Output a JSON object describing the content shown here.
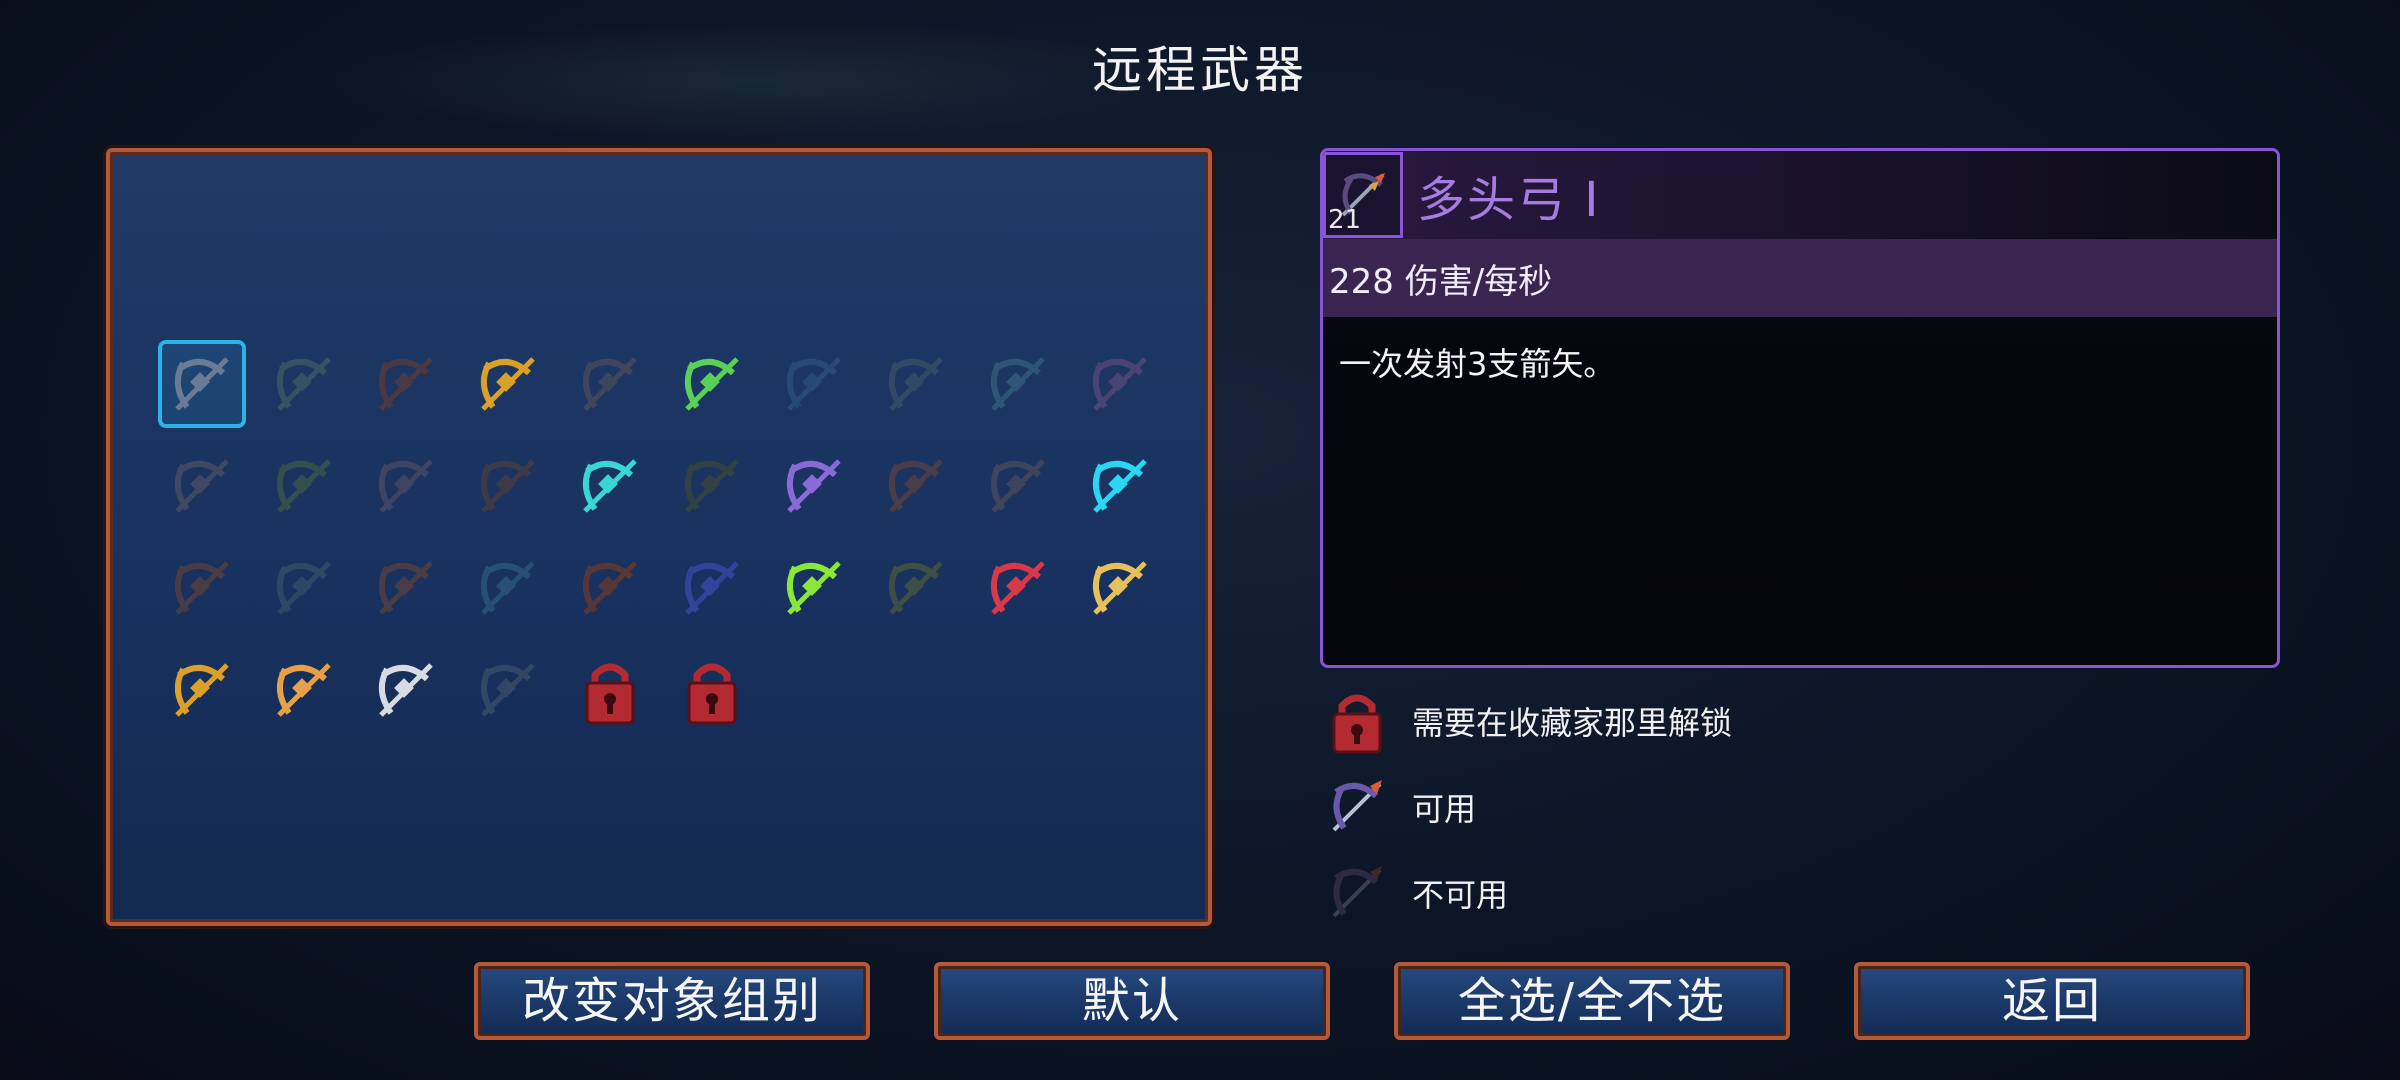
{
  "title": "远程武器",
  "grid": {
    "items": [
      {
        "name": "multiple-nocks-bow",
        "state": "selected",
        "color": "#6a7c95"
      },
      {
        "name": "crossbow-icon",
        "state": "unavailable",
        "color": "#3f5c63"
      },
      {
        "name": "bow-icon",
        "state": "unavailable",
        "color": "#5a3a3a"
      },
      {
        "name": "golden-crossbow-icon",
        "state": "available",
        "color": "#d9a12a"
      },
      {
        "name": "bow-icon",
        "state": "unavailable",
        "color": "#4a4c5a"
      },
      {
        "name": "green-bow-icon",
        "state": "available",
        "color": "#5ad05a"
      },
      {
        "name": "crossbow-icon",
        "state": "unavailable",
        "color": "#2d4f7d"
      },
      {
        "name": "crossbow-icon",
        "state": "unavailable",
        "color": "#3a5068"
      },
      {
        "name": "crossbow-icon",
        "state": "unavailable",
        "color": "#35607d"
      },
      {
        "name": "crossbow-icon",
        "state": "unavailable",
        "color": "#5a4a7d"
      },
      {
        "name": "crossbow-icon",
        "state": "unavailable",
        "color": "#4a5064"
      },
      {
        "name": "crossbow-icon",
        "state": "unavailable",
        "color": "#3c5a4a"
      },
      {
        "name": "boomerang-icon",
        "state": "unavailable",
        "color": "#4a4a62"
      },
      {
        "name": "pickaxe-icon",
        "state": "unavailable",
        "color": "#4a3c40"
      },
      {
        "name": "ice-pickaxe-icon",
        "state": "available",
        "color": "#3ad6d6"
      },
      {
        "name": "spear-icon",
        "state": "unavailable",
        "color": "#3a463a"
      },
      {
        "name": "magic-crossbow-icon",
        "state": "available",
        "color": "#8a6ad6"
      },
      {
        "name": "bow-icon",
        "state": "unavailable",
        "color": "#5a4040"
      },
      {
        "name": "kunai-icon",
        "state": "unavailable",
        "color": "#4a4a5a"
      },
      {
        "name": "lightning-whip-icon",
        "state": "available",
        "color": "#2ad6f2"
      },
      {
        "name": "fire-ring-icon",
        "state": "unavailable",
        "color": "#5a4040"
      },
      {
        "name": "ice-shards-icon",
        "state": "unavailable",
        "color": "#34506a"
      },
      {
        "name": "fireball-icon",
        "state": "unavailable",
        "color": "#5a4040"
      },
      {
        "name": "ice-wave-icon",
        "state": "unavailable",
        "color": "#2d5a7d"
      },
      {
        "name": "fire-blast-icon",
        "state": "unavailable",
        "color": "#6a3a2a"
      },
      {
        "name": "ice-blast-icon",
        "state": "unavailable",
        "color": "#3a4ab0"
      },
      {
        "name": "poison-shards-icon",
        "state": "available",
        "color": "#8ae63a"
      },
      {
        "name": "wand-icon",
        "state": "unavailable",
        "color": "#4a5a3a"
      },
      {
        "name": "cards-icon",
        "state": "available",
        "color": "#d63a4a"
      },
      {
        "name": "golden-bow-icon",
        "state": "available",
        "color": "#e6c05a"
      },
      {
        "name": "pouch-icon",
        "state": "available",
        "color": "#d9a12a"
      },
      {
        "name": "fire-bow-icon",
        "state": "available",
        "color": "#e6a04a"
      },
      {
        "name": "cleaver-icon",
        "state": "available",
        "color": "#d8dce2"
      },
      {
        "name": "boomerang-icon",
        "state": "unavailable",
        "color": "#3a5068"
      },
      {
        "name": "lock-icon",
        "state": "locked",
        "color": "#b42a32"
      },
      {
        "name": "lock-icon",
        "state": "locked",
        "color": "#b42a32"
      }
    ]
  },
  "info": {
    "name": "多头弓 I",
    "count": "21",
    "stat": "228 伤害/每秒",
    "description": "一次发射3支箭矢。",
    "accent": "#8a54d6"
  },
  "legend": {
    "locked": "需要在收藏家那里解锁",
    "available": "可用",
    "unavailable": "不可用"
  },
  "buttons": {
    "change_group": "改变对象组别",
    "default": "默认",
    "select_all": "全选/全不选",
    "back": "返回"
  }
}
